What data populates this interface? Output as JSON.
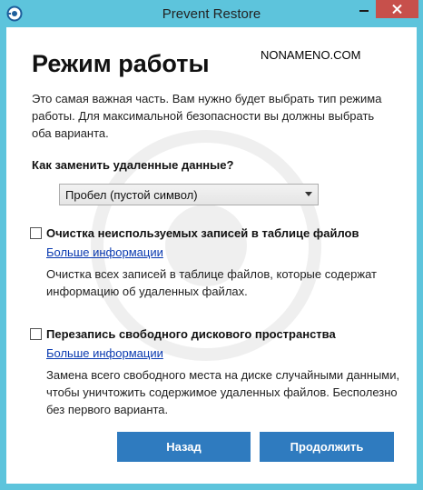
{
  "window": {
    "title": "Prevent Restore",
    "watermark": "NONAMENO.COM"
  },
  "colors": {
    "frame": "#5dc4dc",
    "close_button": "#c7504b",
    "primary_button": "#2f7bbf",
    "link": "#0a3ab0"
  },
  "page": {
    "heading": "Режим работы",
    "intro": "Это самая важная часть. Вам нужно будет выбрать тип режима работы. Для максимальной безопасности вы должны выбрать оба варианта.",
    "question": "Как заменить удаленные данные?",
    "replace_select": {
      "selected": "Пробел (пустой символ)"
    }
  },
  "options": [
    {
      "label": "Очистка неиспользуемых записей в таблице файлов",
      "checked": false,
      "more_link": "Больше информации",
      "description": "Очистка всех записей в таблице файлов, которые содержат информацию об удаленных файлах."
    },
    {
      "label": "Перезапись свободного дискового пространства",
      "checked": false,
      "more_link": "Больше информации",
      "description": "Замена всего свободного места на диске случайными данными, чтобы уничтожить содержимое удаленных файлов. Бесполезно без первого варианта."
    }
  ],
  "buttons": {
    "back": "Назад",
    "continue": "Продолжить"
  }
}
